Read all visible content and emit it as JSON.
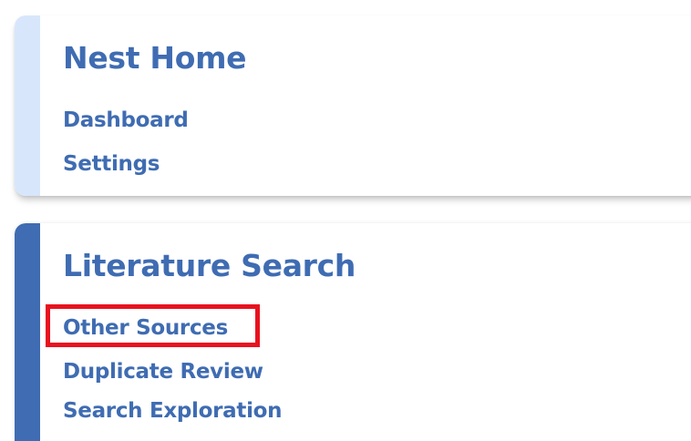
{
  "sections": [
    {
      "title": "Nest Home",
      "links": [
        "Dashboard",
        "Settings"
      ]
    },
    {
      "title": "Literature Search",
      "links": [
        "Other Sources",
        "Duplicate Review",
        "Search Exploration"
      ]
    }
  ],
  "colors": {
    "link_text": "#3f6cb2",
    "home_accent": "#d8e6fb",
    "literature_accent": "#3f6cb2",
    "highlight_border": "#e8121f"
  },
  "highlight": {
    "target": "Other Sources"
  }
}
